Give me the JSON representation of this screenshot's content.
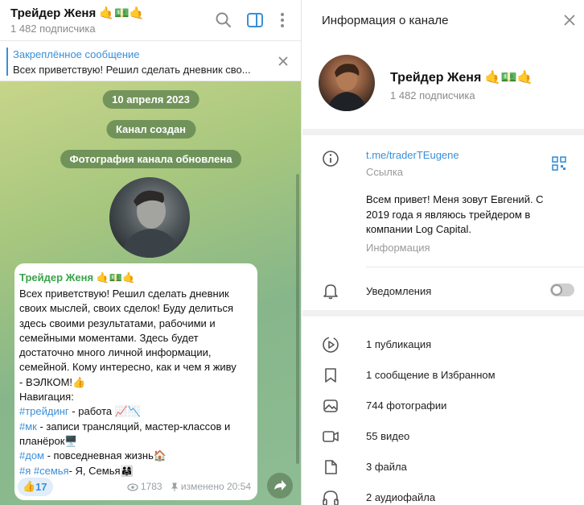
{
  "chat": {
    "title": "Трейдер Женя 🤙💵🤙",
    "subscribers": "1 482 подписчика",
    "pinned_title": "Закреплённое сообщение",
    "pinned_text": "Всех приветствую! Решил сделать дневник сво..."
  },
  "service": {
    "date": "10 апреля 2023",
    "created": "Канал создан",
    "photo_updated": "Фотография канала обновлена"
  },
  "message": {
    "author": "Трейдер Женя 🤙💵🤙",
    "lines": [
      "Всех приветствую! Решил сделать дневник",
      "своих мыслей, своих сделок! Буду делиться",
      "здесь своими результатами, рабочими и",
      "семейными моментами. Здесь будет",
      "достаточно много личной информации,",
      "семейной. Кому интересно, как и чем я живу",
      "- ВЭЛКОМ!👍",
      "Навигация:"
    ],
    "nav": [
      {
        "tag": "#трейдинг",
        "text": " - работа 📈📉"
      },
      {
        "tag": "#мк",
        "text": " - записи трансляций, мастер-классов и"
      },
      {
        "tag": "",
        "text": "планёрок🖥️"
      },
      {
        "tag": "#дом",
        "text": " - повседневная жизнь🏠"
      },
      {
        "tag": "#я #семья",
        "text": "- Я, Семья👨‍👩‍👧"
      }
    ],
    "reaction_emoji": "👍",
    "reaction_count": "17",
    "views": "1783",
    "edited": "изменено 20:54"
  },
  "info": {
    "header": "Информация о канале",
    "name": "Трейдер Женя 🤙💵🤙",
    "subscribers": "1 482 подписчика",
    "link": "t.me/traderTEugene",
    "link_label": "Ссылка",
    "about": "Всем привет! Меня зовут Евгений. С 2019 года я являюсь трейдером в компании Log Capital.",
    "about_label": "Информация",
    "notifications": "Уведомления",
    "notifications_on": false,
    "media": [
      {
        "icon": "publication-icon",
        "label": "1 публикация"
      },
      {
        "icon": "bookmark-icon",
        "label": "1 сообщение в Избранном"
      },
      {
        "icon": "photo-icon",
        "label": "744 фотографии"
      },
      {
        "icon": "video-icon",
        "label": "55 видео"
      },
      {
        "icon": "file-icon",
        "label": "3 файла"
      },
      {
        "icon": "headphones-icon",
        "label": "2 аудиофайла"
      }
    ]
  }
}
